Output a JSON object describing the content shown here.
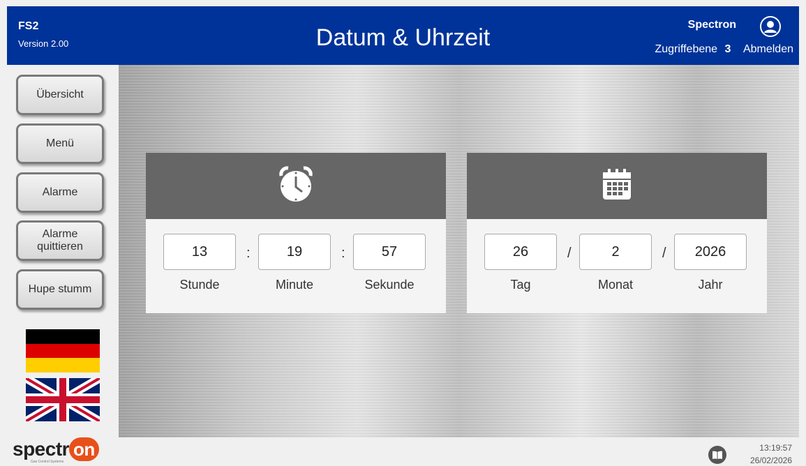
{
  "header": {
    "app_name": "FS2",
    "version": "Version 2.00",
    "title": "Datum & Uhrzeit",
    "user": "Spectron",
    "access_label": "Zugriffebene",
    "access_level": "3",
    "logout": "Abmelden"
  },
  "sidebar": {
    "buttons": [
      "Übersicht",
      "Menü",
      "Alarme",
      "Alarme quittieren",
      "Hupe stumm"
    ],
    "languages": [
      "german-flag",
      "uk-flag"
    ]
  },
  "time_panel": {
    "icon": "alarm-clock-icon",
    "hour": "13",
    "minute": "19",
    "second": "57",
    "sep": ":",
    "labels": {
      "hour": "Stunde",
      "minute": "Minute",
      "second": "Sekunde"
    }
  },
  "date_panel": {
    "icon": "calendar-icon",
    "day": "26",
    "month": "2",
    "year": "2026",
    "sep": "/",
    "labels": {
      "day": "Tag",
      "month": "Monat",
      "year": "Jahr"
    }
  },
  "footer": {
    "logo_text": "spectr",
    "logo_on": "on",
    "tagline": "Gas Control Systems",
    "time": "13:19:57",
    "date": "26/02/2026"
  },
  "colors": {
    "header_bg": "#003399",
    "panel_head": "#666666",
    "logo_accent": "#e8501a"
  }
}
